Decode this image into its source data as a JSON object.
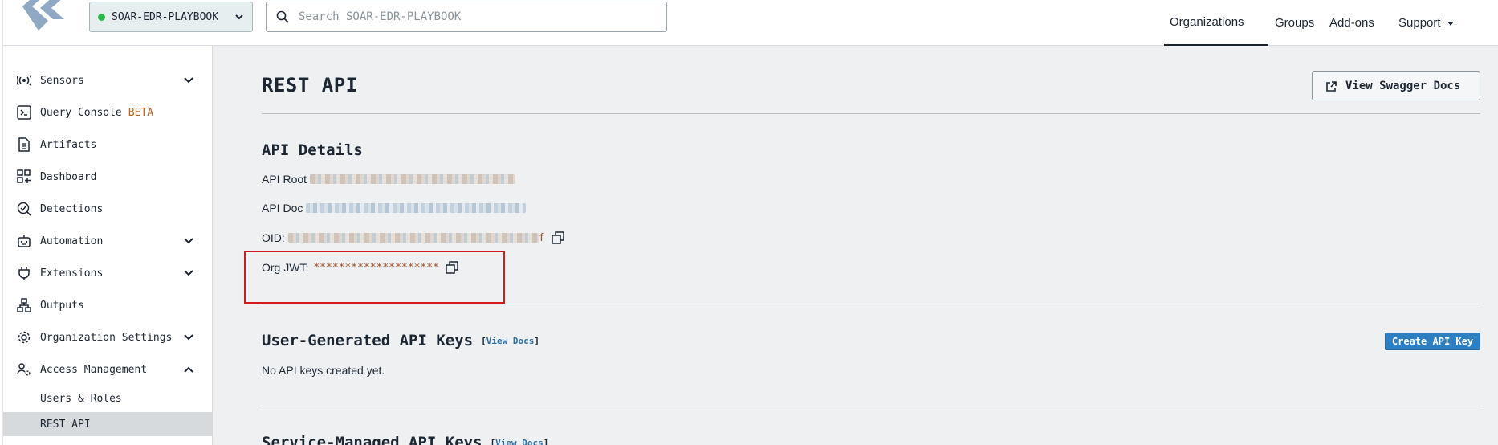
{
  "header": {
    "org_name": "SOAR-EDR-PLAYBOOK",
    "search_placeholder": "Search SOAR-EDR-PLAYBOOK",
    "nav": [
      "Organizations",
      "Groups",
      "Add-ons",
      "Support"
    ]
  },
  "sidebar": {
    "items": [
      {
        "label": "Sensors",
        "icon": "sensor-icon",
        "expandable": true
      },
      {
        "label": "Query Console",
        "badge": "BETA",
        "icon": "terminal-icon"
      },
      {
        "label": "Artifacts",
        "icon": "document-icon"
      },
      {
        "label": "Dashboard",
        "icon": "dashboard-icon"
      },
      {
        "label": "Detections",
        "icon": "detection-icon"
      },
      {
        "label": "Automation",
        "icon": "robot-icon",
        "expandable": true
      },
      {
        "label": "Extensions",
        "icon": "plug-icon",
        "expandable": true
      },
      {
        "label": "Outputs",
        "icon": "outputs-icon"
      },
      {
        "label": "Organization Settings",
        "icon": "gear-icon",
        "expandable": true
      },
      {
        "label": "Access Management",
        "icon": "user-gear-icon",
        "expanded": true
      }
    ],
    "subitems": [
      {
        "label": "Users & Roles"
      },
      {
        "label": "REST API",
        "active": true
      }
    ]
  },
  "main": {
    "title": "REST API",
    "swagger_label": "View Swagger Docs",
    "details_title": "API Details",
    "api_root_label": "API Root",
    "api_doc_label": "API Doc",
    "oid_label": "OID:",
    "oid_visible_suffix": "f",
    "org_jwt_label": "Org JWT:",
    "org_jwt_value": "********************",
    "user_keys_title": "User-Generated API Keys",
    "view_docs": "View Docs",
    "create_key_label": "Create API Key",
    "no_keys_text": "No API keys created yet.",
    "service_keys_title": "Service-Managed API Keys"
  },
  "colors": {
    "accent": "#2d7fc1",
    "highlight": "#d11a1a",
    "status": "#2eb84b",
    "beta": "#b7621b"
  }
}
